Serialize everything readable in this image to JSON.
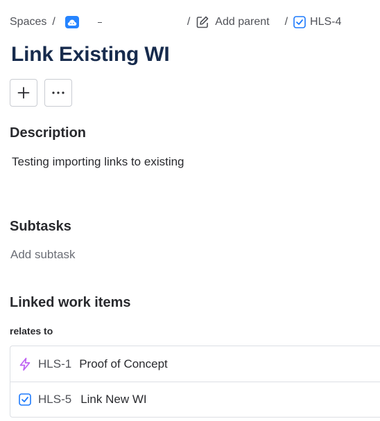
{
  "breadcrumb": {
    "spaces_label": "Spaces",
    "separator": "/",
    "space_name": "",
    "add_parent_label": "Add parent",
    "issue_key": "HLS-4"
  },
  "issue": {
    "title": "Link Existing WI"
  },
  "actions": {
    "add_icon": "plus-icon",
    "more_icon": "more-icon"
  },
  "description": {
    "heading": "Description",
    "text": "Testing importing links to existing"
  },
  "subtasks": {
    "heading": "Subtasks",
    "placeholder": "Add subtask"
  },
  "linked": {
    "heading": "Linked work items",
    "relation": "relates to",
    "items": [
      {
        "key": "HLS-1",
        "summary": "Proof of Concept",
        "type_icon": "epic-lightning-icon",
        "color": "#bf63f3"
      },
      {
        "key": "HLS-5",
        "summary": "Link New WI",
        "type_icon": "task-checkbox-icon",
        "color": "#1d7afc"
      }
    ]
  },
  "colors": {
    "space_icon": "#2684ff",
    "task_blue": "#1d7afc",
    "epic_purple": "#bf63f3"
  }
}
